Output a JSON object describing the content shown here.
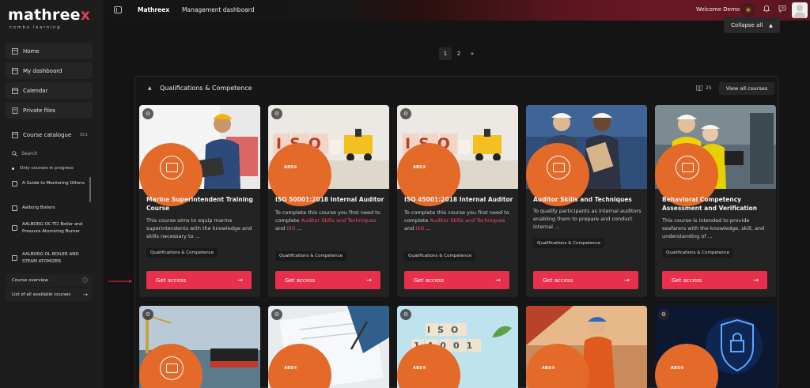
{
  "app": {
    "logo_text": "mathree",
    "logo_x": "x",
    "logo_tagline": "combo learning"
  },
  "sidebar": {
    "home": "Home",
    "my_dashboard": "My dashboard",
    "calendar": "Calendar",
    "private_files": "Private files",
    "catalogue_label": "Course catalogue",
    "catalogue_count": "351",
    "search_placeholder": "Search",
    "progress_filter": "Only courses in progress",
    "courses": [
      "A Guide to Mentoring Others",
      "Aalborg Boilers",
      "AALBORG OC-TCI Boiler and Pressure Atomizing Burner",
      "AALBORG OL BOILER AND STEAM ATOMIZER"
    ],
    "course_overview": "Course overview",
    "all_courses": "List of all available courses"
  },
  "topbar": {
    "brand": "Mathreex",
    "management": "Management dashboard",
    "welcome": "Welcome Demo"
  },
  "main": {
    "collapse_all": "Collapse all",
    "pages": [
      "1",
      "2",
      "»"
    ],
    "section": {
      "title": "Qualifications & Competence",
      "count": "25",
      "view_all": "View all courses"
    },
    "get_access": "Get access",
    "abs_logo": "ABS",
    "abs_mark": "®",
    "cards": [
      {
        "title": "Marine Superintendent Training Course",
        "desc": "This course aims to equip marine superintendents with the knowledge and skills necessary to ...",
        "tag": "Qualifications & Competence"
      },
      {
        "title": "ISO 50001:2018 Internal Auditor",
        "desc_pre": "To complete this course you first need to complete ",
        "desc_link1": "Auditor Skills and Techniques",
        "desc_mid": " and ",
        "desc_link2": "ISO",
        "desc_post": " ...",
        "tag": "Qualifications & Competence",
        "img_text": "ISO"
      },
      {
        "title": "ISO 45001:2018 Internal Auditor",
        "desc_pre": "To complete this course you first need to complete ",
        "desc_link1": "Auditor Skills and Techniques",
        "desc_mid": " and ",
        "desc_link2": "ISO",
        "desc_post": " ...",
        "tag": "Qualifications & Competence",
        "img_text": "ISO"
      },
      {
        "title": "Auditor Skills and Techniques",
        "desc": "To qualify participants as internal auditors enabling them to prepare and conduct internal ...",
        "tag": "Qualifications & Competence"
      },
      {
        "title": "Behavioral Competency Assessment and Verification",
        "desc": "This course is intended to provide seafarers with the knowledge, skill, and understanding of ...",
        "tag": "Qualifications & Competence"
      }
    ],
    "row2_img_text": [
      "ISO",
      "14001"
    ]
  },
  "colors": {
    "accent": "#e8304c",
    "badge_orange": "#e46a2a",
    "annotation_arrow": "#d0202a"
  }
}
